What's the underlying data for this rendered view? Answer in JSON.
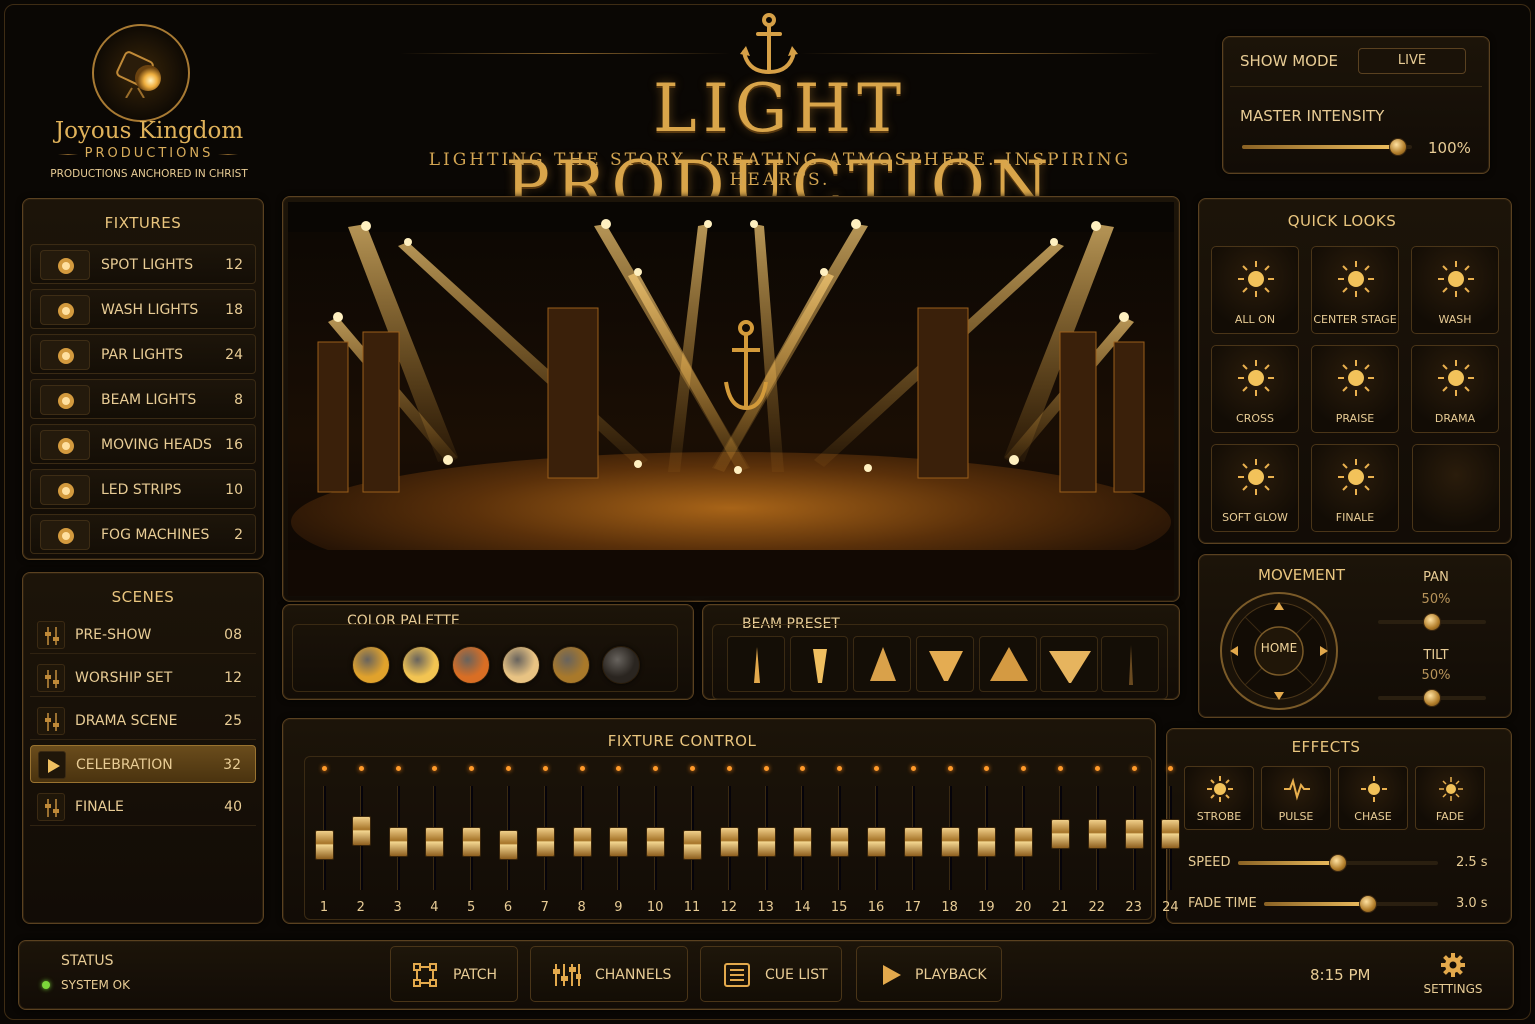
{
  "brand": {
    "name": "Joyous Kingdom",
    "sub": "PRODUCTIONS",
    "tagline": "PRODUCTIONS ANCHORED IN CHRIST"
  },
  "header": {
    "title": "LIGHT PRODUCTION",
    "subtitle": "LIGHTING THE STORY. CREATING ATMOSPHERE. INSPIRING HEARTS."
  },
  "show": {
    "mode_label": "SHOW MODE",
    "mode_value": "LIVE",
    "master_label": "MASTER INTENSITY",
    "master_value": "100%",
    "master_level": 0.92
  },
  "fixtures": {
    "title": "FIXTURES",
    "items": [
      {
        "label": "SPOT LIGHTS",
        "count": "12",
        "icon": "spotlight-icon"
      },
      {
        "label": "WASH LIGHTS",
        "count": "18",
        "icon": "wash-light-icon"
      },
      {
        "label": "PAR LIGHTS",
        "count": "24",
        "icon": "par-light-icon"
      },
      {
        "label": "BEAM LIGHTS",
        "count": "8",
        "icon": "beam-light-icon"
      },
      {
        "label": "MOVING HEADS",
        "count": "16",
        "icon": "moving-head-icon"
      },
      {
        "label": "LED STRIPS",
        "count": "10",
        "icon": "led-strip-icon"
      },
      {
        "label": "FOG MACHINES",
        "count": "2",
        "icon": "fog-machine-icon"
      }
    ]
  },
  "scenes": {
    "title": "SCENES",
    "items": [
      {
        "label": "PRE-SHOW",
        "count": "08"
      },
      {
        "label": "WORSHIP SET",
        "count": "12"
      },
      {
        "label": "DRAMA SCENE",
        "count": "25"
      },
      {
        "label": "CELEBRATION",
        "count": "32",
        "active": true
      },
      {
        "label": "FINALE",
        "count": "40"
      }
    ]
  },
  "quick_looks": {
    "title": "QUICK LOOKS",
    "items": [
      "ALL ON",
      "CENTER STAGE",
      "WASH",
      "CROSS",
      "PRAISE",
      "DRAMA",
      "SOFT GLOW",
      "FINALE"
    ]
  },
  "movement": {
    "title": "MOVEMENT",
    "home": "HOME",
    "pan_label": "PAN",
    "pan_value": "50%",
    "tilt_label": "TILT",
    "tilt_value": "50%"
  },
  "color_palette": {
    "title": "COLOR PALETTE",
    "colors": [
      "#e0a22c",
      "#f2c452",
      "#d96e24",
      "#e8c383",
      "#a9792a",
      "#2a2520"
    ]
  },
  "beam_preset": {
    "title": "BEAM PRESET"
  },
  "fixture_control": {
    "title": "FIXTURE CONTROL",
    "channels": [
      {
        "n": "1",
        "level": 0.4
      },
      {
        "n": "2",
        "level": 0.6
      },
      {
        "n": "3",
        "level": 0.45
      },
      {
        "n": "4",
        "level": 0.45
      },
      {
        "n": "5",
        "level": 0.45
      },
      {
        "n": "6",
        "level": 0.4
      },
      {
        "n": "7",
        "level": 0.45
      },
      {
        "n": "8",
        "level": 0.45
      },
      {
        "n": "9",
        "level": 0.45
      },
      {
        "n": "10",
        "level": 0.45
      },
      {
        "n": "11",
        "level": 0.4
      },
      {
        "n": "12",
        "level": 0.45
      },
      {
        "n": "13",
        "level": 0.45
      },
      {
        "n": "14",
        "level": 0.45
      },
      {
        "n": "15",
        "level": 0.45
      },
      {
        "n": "16",
        "level": 0.45
      },
      {
        "n": "17",
        "level": 0.45
      },
      {
        "n": "18",
        "level": 0.45
      },
      {
        "n": "19",
        "level": 0.45
      },
      {
        "n": "20",
        "level": 0.45
      },
      {
        "n": "21",
        "level": 0.55
      },
      {
        "n": "22",
        "level": 0.55
      },
      {
        "n": "23",
        "level": 0.55
      },
      {
        "n": "24",
        "level": 0.55
      }
    ]
  },
  "effects": {
    "title": "EFFECTS",
    "items": [
      "STROBE",
      "PULSE",
      "CHASE",
      "FADE"
    ],
    "speed_label": "SPEED",
    "speed_value": "2.5 s",
    "speed_level": 0.5,
    "fade_label": "FADE TIME",
    "fade_value": "3.0 s",
    "fade_level": 0.6
  },
  "status": {
    "label": "STATUS",
    "value": "SYSTEM OK"
  },
  "bottom": {
    "patch": "PATCH",
    "channels": "CHANNELS",
    "cue_list": "CUE LIST",
    "playback": "PLAYBACK",
    "time": "8:15 PM",
    "settings": "SETTINGS"
  }
}
